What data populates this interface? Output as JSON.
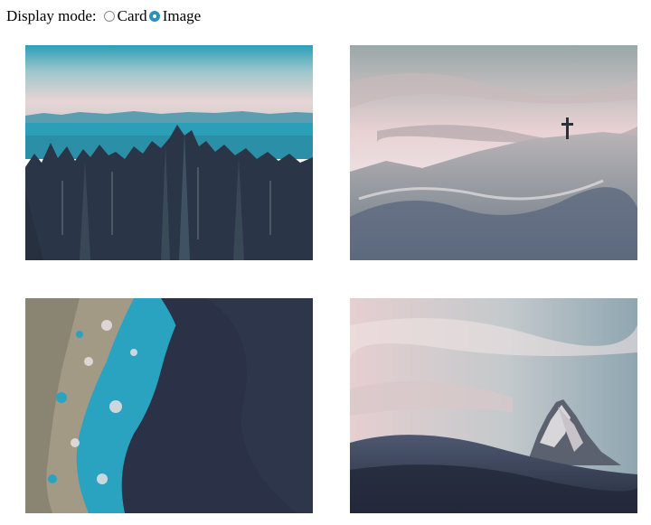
{
  "display_mode": {
    "label": "Display mode:",
    "options": [
      {
        "label": "Card",
        "selected": false
      },
      {
        "label": "Image",
        "selected": true
      }
    ],
    "accent_color": "#2a93b8"
  },
  "images": [
    {
      "subject": "forest-lake-mountains"
    },
    {
      "subject": "snowy-ridge-summit-cross"
    },
    {
      "subject": "aerial-coastline-ocean"
    },
    {
      "subject": "matterhorn-peak-snow-dunes"
    }
  ]
}
